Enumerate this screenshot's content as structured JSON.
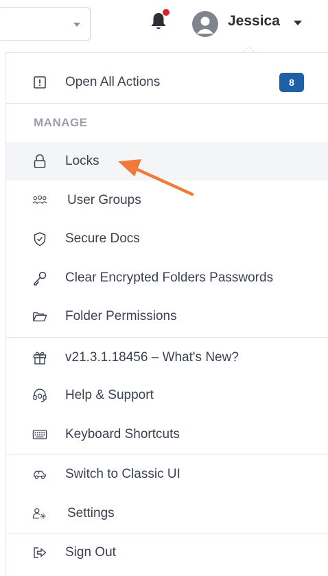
{
  "header": {
    "user_name": "Jessica"
  },
  "menu": {
    "open_all_actions": {
      "label": "Open All Actions",
      "badge": "8"
    },
    "section_manage": "MANAGE",
    "manage_items": [
      {
        "label": "Locks",
        "icon": "lock-icon"
      },
      {
        "label": "User Groups",
        "icon": "user-groups-icon"
      },
      {
        "label": "Secure Docs",
        "icon": "shield-icon"
      },
      {
        "label": "Clear Encrypted Folders Passwords",
        "icon": "key-icon"
      },
      {
        "label": "Folder Permissions",
        "icon": "folder-open-icon"
      }
    ],
    "info_items": [
      {
        "label": "v21.3.1.18456 – What's New?",
        "icon": "gift-icon"
      },
      {
        "label": "Help & Support",
        "icon": "headset-icon"
      },
      {
        "label": "Keyboard Shortcuts",
        "icon": "keyboard-icon"
      }
    ],
    "switch_classic": {
      "label": "Switch to Classic UI",
      "icon": "car-icon"
    },
    "settings": {
      "label": "Settings",
      "icon": "user-settings-icon"
    },
    "sign_out": {
      "label": "Sign Out",
      "icon": "sign-out-icon"
    }
  },
  "colors": {
    "badge": "#1f5fa6",
    "annotation_arrow": "#f07a3a",
    "notification_dot": "#e02424",
    "active_row": "#f4f5f6"
  }
}
